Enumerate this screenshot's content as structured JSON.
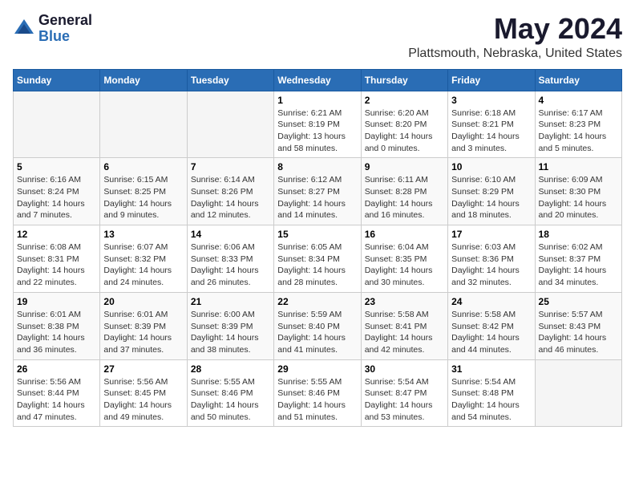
{
  "header": {
    "logo_general": "General",
    "logo_blue": "Blue",
    "month_title": "May 2024",
    "location": "Plattsmouth, Nebraska, United States"
  },
  "weekdays": [
    "Sunday",
    "Monday",
    "Tuesday",
    "Wednesday",
    "Thursday",
    "Friday",
    "Saturday"
  ],
  "weeks": [
    [
      {
        "day": "",
        "info": ""
      },
      {
        "day": "",
        "info": ""
      },
      {
        "day": "",
        "info": ""
      },
      {
        "day": "1",
        "info": "Sunrise: 6:21 AM\nSunset: 8:19 PM\nDaylight: 13 hours\nand 58 minutes."
      },
      {
        "day": "2",
        "info": "Sunrise: 6:20 AM\nSunset: 8:20 PM\nDaylight: 14 hours\nand 0 minutes."
      },
      {
        "day": "3",
        "info": "Sunrise: 6:18 AM\nSunset: 8:21 PM\nDaylight: 14 hours\nand 3 minutes."
      },
      {
        "day": "4",
        "info": "Sunrise: 6:17 AM\nSunset: 8:23 PM\nDaylight: 14 hours\nand 5 minutes."
      }
    ],
    [
      {
        "day": "5",
        "info": "Sunrise: 6:16 AM\nSunset: 8:24 PM\nDaylight: 14 hours\nand 7 minutes."
      },
      {
        "day": "6",
        "info": "Sunrise: 6:15 AM\nSunset: 8:25 PM\nDaylight: 14 hours\nand 9 minutes."
      },
      {
        "day": "7",
        "info": "Sunrise: 6:14 AM\nSunset: 8:26 PM\nDaylight: 14 hours\nand 12 minutes."
      },
      {
        "day": "8",
        "info": "Sunrise: 6:12 AM\nSunset: 8:27 PM\nDaylight: 14 hours\nand 14 minutes."
      },
      {
        "day": "9",
        "info": "Sunrise: 6:11 AM\nSunset: 8:28 PM\nDaylight: 14 hours\nand 16 minutes."
      },
      {
        "day": "10",
        "info": "Sunrise: 6:10 AM\nSunset: 8:29 PM\nDaylight: 14 hours\nand 18 minutes."
      },
      {
        "day": "11",
        "info": "Sunrise: 6:09 AM\nSunset: 8:30 PM\nDaylight: 14 hours\nand 20 minutes."
      }
    ],
    [
      {
        "day": "12",
        "info": "Sunrise: 6:08 AM\nSunset: 8:31 PM\nDaylight: 14 hours\nand 22 minutes."
      },
      {
        "day": "13",
        "info": "Sunrise: 6:07 AM\nSunset: 8:32 PM\nDaylight: 14 hours\nand 24 minutes."
      },
      {
        "day": "14",
        "info": "Sunrise: 6:06 AM\nSunset: 8:33 PM\nDaylight: 14 hours\nand 26 minutes."
      },
      {
        "day": "15",
        "info": "Sunrise: 6:05 AM\nSunset: 8:34 PM\nDaylight: 14 hours\nand 28 minutes."
      },
      {
        "day": "16",
        "info": "Sunrise: 6:04 AM\nSunset: 8:35 PM\nDaylight: 14 hours\nand 30 minutes."
      },
      {
        "day": "17",
        "info": "Sunrise: 6:03 AM\nSunset: 8:36 PM\nDaylight: 14 hours\nand 32 minutes."
      },
      {
        "day": "18",
        "info": "Sunrise: 6:02 AM\nSunset: 8:37 PM\nDaylight: 14 hours\nand 34 minutes."
      }
    ],
    [
      {
        "day": "19",
        "info": "Sunrise: 6:01 AM\nSunset: 8:38 PM\nDaylight: 14 hours\nand 36 minutes."
      },
      {
        "day": "20",
        "info": "Sunrise: 6:01 AM\nSunset: 8:39 PM\nDaylight: 14 hours\nand 37 minutes."
      },
      {
        "day": "21",
        "info": "Sunrise: 6:00 AM\nSunset: 8:39 PM\nDaylight: 14 hours\nand 38 minutes."
      },
      {
        "day": "22",
        "info": "Sunrise: 5:59 AM\nSunset: 8:40 PM\nDaylight: 14 hours\nand 41 minutes."
      },
      {
        "day": "23",
        "info": "Sunrise: 5:58 AM\nSunset: 8:41 PM\nDaylight: 14 hours\nand 42 minutes."
      },
      {
        "day": "24",
        "info": "Sunrise: 5:58 AM\nSunset: 8:42 PM\nDaylight: 14 hours\nand 44 minutes."
      },
      {
        "day": "25",
        "info": "Sunrise: 5:57 AM\nSunset: 8:43 PM\nDaylight: 14 hours\nand 46 minutes."
      }
    ],
    [
      {
        "day": "26",
        "info": "Sunrise: 5:56 AM\nSunset: 8:44 PM\nDaylight: 14 hours\nand 47 minutes."
      },
      {
        "day": "27",
        "info": "Sunrise: 5:56 AM\nSunset: 8:45 PM\nDaylight: 14 hours\nand 49 minutes."
      },
      {
        "day": "28",
        "info": "Sunrise: 5:55 AM\nSunset: 8:46 PM\nDaylight: 14 hours\nand 50 minutes."
      },
      {
        "day": "29",
        "info": "Sunrise: 5:55 AM\nSunset: 8:46 PM\nDaylight: 14 hours\nand 51 minutes."
      },
      {
        "day": "30",
        "info": "Sunrise: 5:54 AM\nSunset: 8:47 PM\nDaylight: 14 hours\nand 53 minutes."
      },
      {
        "day": "31",
        "info": "Sunrise: 5:54 AM\nSunset: 8:48 PM\nDaylight: 14 hours\nand 54 minutes."
      },
      {
        "day": "",
        "info": ""
      }
    ]
  ]
}
